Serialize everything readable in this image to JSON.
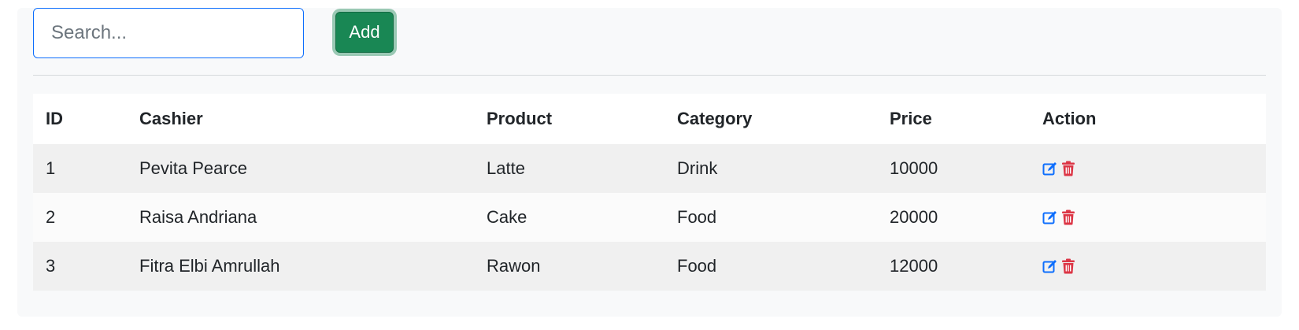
{
  "search": {
    "placeholder": "Search...",
    "value": ""
  },
  "toolbar": {
    "add_label": "Add"
  },
  "table": {
    "headers": {
      "id": "ID",
      "cashier": "Cashier",
      "product": "Product",
      "category": "Category",
      "price": "Price",
      "action": "Action"
    },
    "rows": [
      {
        "id": "1",
        "cashier": "Pevita Pearce",
        "product": "Latte",
        "category": "Drink",
        "price": "10000"
      },
      {
        "id": "2",
        "cashier": "Raisa Andriana",
        "product": "Cake",
        "category": "Food",
        "price": "20000"
      },
      {
        "id": "3",
        "cashier": "Fitra Elbi Amrullah",
        "product": "Rawon",
        "category": "Food",
        "price": "12000"
      }
    ]
  },
  "icons": {
    "edit": "edit-icon",
    "delete": "trash-icon"
  },
  "colors": {
    "accent": "#0d6efd",
    "add_button": "#198754",
    "edit_icon": "#0d6efd",
    "delete_icon": "#dc3545"
  }
}
